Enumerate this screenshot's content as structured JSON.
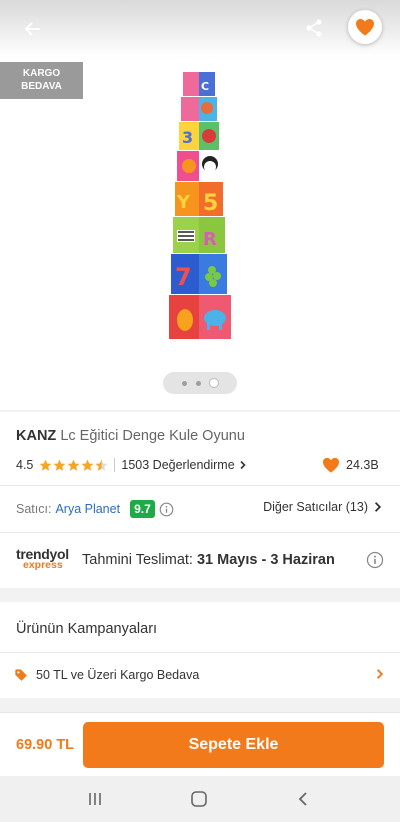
{
  "gallery": {
    "cargo_badge_line1": "KARGO",
    "cargo_badge_line2": "BEDAVA",
    "image_count": 3,
    "active_image_index": 2
  },
  "product": {
    "brand": "KANZ",
    "name": "Lc Eğitici Denge Kule Oyunu",
    "rating": "4.5",
    "rating_value": 4.5,
    "review_count_label": "1503 Değerlendirme",
    "favorite_count": "24.3B"
  },
  "seller": {
    "label": "Satıcı:",
    "name": "Arya Planet",
    "score": "9.7",
    "other_sellers_label": "Diğer Satıcılar (13)"
  },
  "delivery": {
    "logo_line1": "trendyol",
    "logo_line2": "express",
    "label": "Tahmini Teslimat:",
    "date": "31 Mayıs - 3 Haziran"
  },
  "campaigns": {
    "title": "Ürünün Kampanyaları",
    "items": [
      {
        "label": "50 TL ve Üzeri Kargo Bedava"
      }
    ]
  },
  "actionbar": {
    "price": "69.90 TL",
    "add_to_cart_label": "Sepete Ekle"
  },
  "icons": {
    "back": "arrow-left-icon",
    "share": "share-icon",
    "favorite": "heart-icon",
    "info": "info-icon",
    "tag": "tag-icon",
    "chevron": "chevron-right-icon"
  },
  "colors": {
    "accent": "#f27a1a",
    "link": "#2a6fbf",
    "score_badge": "#1faa48",
    "star": "#f5a623",
    "badge_gray": "#9a9a9a"
  }
}
